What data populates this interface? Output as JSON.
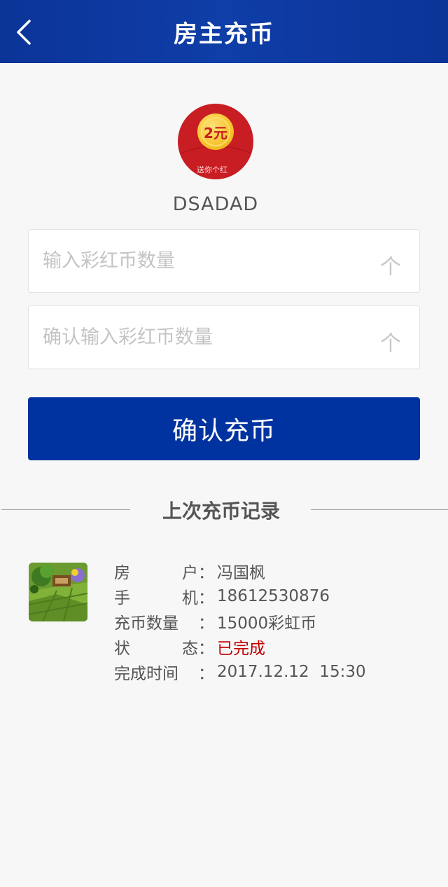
{
  "header": {
    "title": "房主充币"
  },
  "profile": {
    "coin_label": "2元",
    "envelope_text": "爱的，送你个红",
    "username": "DSADAD"
  },
  "form": {
    "amount_placeholder": "输入彩红币数量",
    "confirm_placeholder": "确认输入彩红币数量",
    "unit": "个",
    "submit_label": "确认充币"
  },
  "last_record": {
    "section_title": "上次充币记录",
    "rows": [
      {
        "label_a": "房",
        "label_b": "户",
        "value": "冯国枫"
      },
      {
        "label_a": "手",
        "label_b": "机",
        "value": " 18612530876"
      },
      {
        "label_a": "充币数量",
        "label_b": "",
        "value": "15000彩虹币"
      },
      {
        "label_a": "状",
        "label_b": "态",
        "value": "已完成"
      },
      {
        "label_a": "完成时间",
        "label_b": "",
        "value": "2017.12.12  15:30"
      }
    ],
    "colon": "："
  },
  "colors": {
    "header_bg": "#0b3497",
    "button_bg": "#0133a0",
    "status_done": "#c00000"
  }
}
